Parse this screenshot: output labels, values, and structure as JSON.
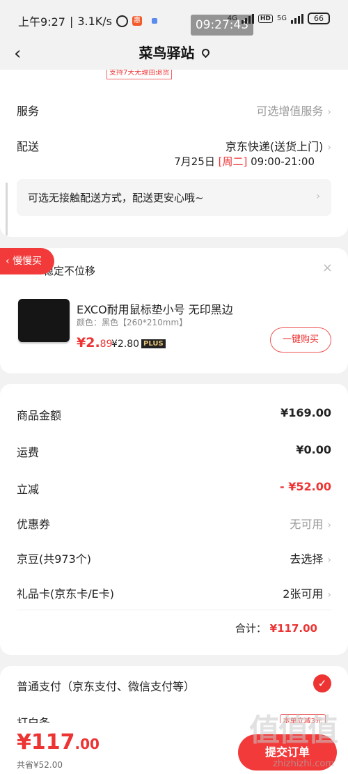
{
  "status_bar": {
    "time_left": "上午9:27",
    "speed": "3.1K/s",
    "time_pill": "09:27:43",
    "net1": "4G",
    "hd": "HD",
    "net2": "5G",
    "battery": "66"
  },
  "navbar": {
    "back": "‹",
    "title": "菜鸟驿站"
  },
  "top_card": {
    "partial_badge": "支持7天无理由退货",
    "service_label": "服务",
    "service_value": "可选增值服务",
    "delivery_label": "配送",
    "delivery_value": "京东快递(送货上门)",
    "date_main": "7月25日",
    "date_weekday": "[周二]",
    "date_time": "09:00-21:00",
    "notice": "可选无接触配送方式，配送更安心哦~",
    "chevron": "›"
  },
  "recommend_card": {
    "slow_buy": "慢慢买",
    "heading": "稳定不位移",
    "close": "×",
    "product_name": "EXCO耐用鼠标垫小号 无印黑边",
    "product_spec": "颜色：黑色【260*210mm】",
    "price_main": "¥2.",
    "price_decimal": "89",
    "plus_price": "¥2.80",
    "plus_badge": "PLUS",
    "buy_button": "一键购买"
  },
  "summary_card": {
    "items": [
      {
        "label": "商品金额",
        "value": "¥169.00"
      },
      {
        "label": "运费",
        "value": "¥0.00"
      },
      {
        "label": "立减",
        "value": "- ¥52.00"
      },
      {
        "label": "优惠券",
        "value": "无可用"
      },
      {
        "label": "京豆(共973个)",
        "value": "去选择"
      },
      {
        "label": "礼品卡(京东卡/E卡)",
        "value": "2张可用"
      }
    ],
    "total_label": "合计：",
    "total_value": "¥117.00"
  },
  "payment_card": {
    "option1": "普通支付（京东支付、微信支付等）",
    "check": "✓",
    "option2": "打白条",
    "promo": "本单立减3元"
  },
  "bottom_bar": {
    "total_main": "¥117",
    "total_decimal": ".00",
    "saved": "共省¥52.00",
    "submit": "提交订单"
  },
  "watermark": {
    "text": "值值值",
    "url": "zhizhizhi.com"
  },
  "colors": {
    "accent": "#e33333",
    "background": "#f2f2f2"
  }
}
